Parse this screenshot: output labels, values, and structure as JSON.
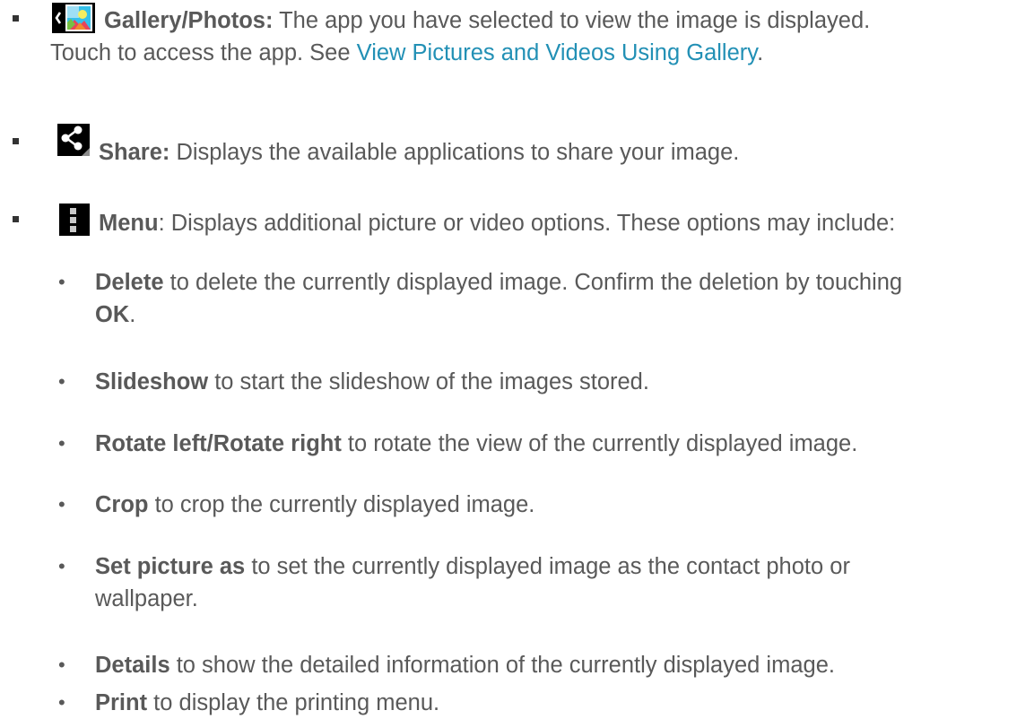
{
  "main_items": [
    {
      "icon": "gallery-photos-icon",
      "label": "Gallery/Photos:",
      "text_line1": " The app you have selected to view the image is displayed.",
      "text_line2_pre": "Touch to access the app. See ",
      "link": "View Pictures and Videos Using Gallery",
      "text_line2_post": "."
    },
    {
      "icon": "share-icon",
      "label": "Share:",
      "text": " Displays the available applications to share your image."
    },
    {
      "icon": "menu-icon",
      "label": "Menu",
      "text": ": Displays additional picture or video options. These options may include:"
    }
  ],
  "menu_options": [
    {
      "term": "Delete",
      "text": " to delete the currently displayed image. Confirm the deletion by touching",
      "term2": "OK",
      "text2": "."
    },
    {
      "term": "Slideshow",
      "text": " to start the slideshow of the images stored."
    },
    {
      "term": "Rotate left/Rotate right",
      "text": " to rotate the view of the currently displayed image."
    },
    {
      "term": "Crop",
      "text": " to crop the currently displayed image."
    },
    {
      "term": "Set picture as",
      "text": " to set the currently displayed image as the contact photo or",
      "text_line2": "wallpaper."
    },
    {
      "term": "Details",
      "text": " to show the detailed information of the currently displayed image."
    },
    {
      "term": "Print",
      "text": " to display the printing menu."
    }
  ],
  "bullet_char": "•"
}
